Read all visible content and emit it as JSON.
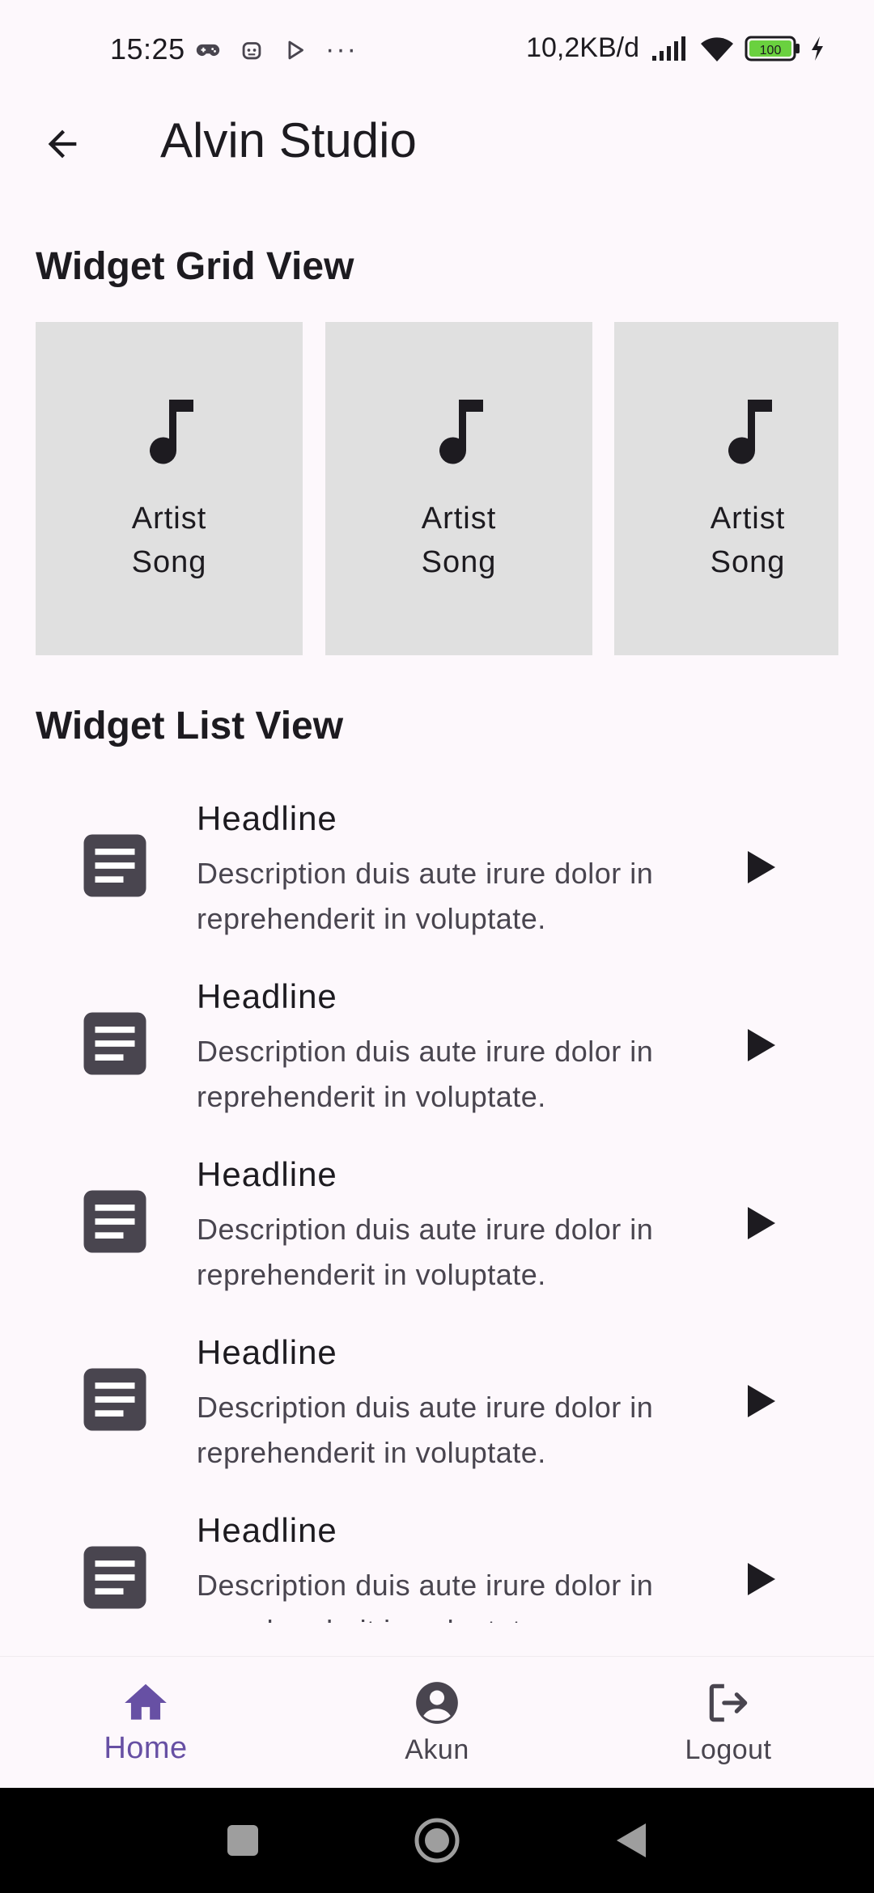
{
  "status_bar": {
    "time": "15:25",
    "more_indicator": "···",
    "net_speed": "10,2KB/d",
    "battery_level": "100"
  },
  "app_bar": {
    "title": "Alvin Studio",
    "back_icon": "arrow-back-icon"
  },
  "grid_section": {
    "title": "Widget Grid View",
    "cards": [
      {
        "icon": "music-note-icon",
        "artist": "Artist",
        "song": "Song"
      },
      {
        "icon": "music-note-icon",
        "artist": "Artist",
        "song": "Song"
      },
      {
        "icon": "music-note-icon",
        "artist": "Artist",
        "song": "Song"
      }
    ]
  },
  "list_section": {
    "title": "Widget List View",
    "items": [
      {
        "icon": "article-icon",
        "headline": "Headline",
        "description": "Description duis aute irure dolor in reprehenderit in voluptate.",
        "trailing_icon": "play-arrow-icon"
      },
      {
        "icon": "article-icon",
        "headline": "Headline",
        "description": "Description duis aute irure dolor in reprehenderit in voluptate.",
        "trailing_icon": "play-arrow-icon"
      },
      {
        "icon": "article-icon",
        "headline": "Headline",
        "description": "Description duis aute irure dolor in reprehenderit in voluptate.",
        "trailing_icon": "play-arrow-icon"
      },
      {
        "icon": "article-icon",
        "headline": "Headline",
        "description": "Description duis aute irure dolor in reprehenderit in voluptate.",
        "trailing_icon": "play-arrow-icon"
      },
      {
        "icon": "article-icon",
        "headline": "Headline",
        "description": "Description duis aute irure dolor in reprehenderit in voluptate.",
        "trailing_icon": "play-arrow-icon"
      }
    ]
  },
  "bottom_nav": {
    "items": [
      {
        "label": "Home",
        "icon": "home-icon",
        "active": true
      },
      {
        "label": "Akun",
        "icon": "account-circle-icon",
        "active": false
      },
      {
        "label": "Logout",
        "icon": "logout-icon",
        "active": false
      }
    ]
  },
  "colors": {
    "background": "#fdf8fc",
    "accent": "#6750a4",
    "card_bg": "#e0e0e0",
    "icon_dark": "#49454f",
    "battery_green": "#6ad13f"
  }
}
